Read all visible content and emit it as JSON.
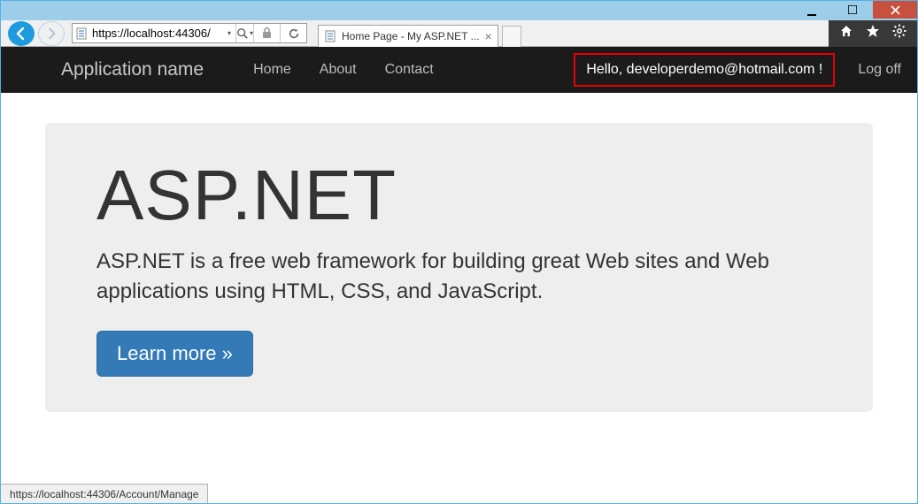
{
  "window": {
    "url": "https://localhost:44306/",
    "tab_title": "Home Page - My ASP.NET ...",
    "status_url": "https://localhost:44306/Account/Manage"
  },
  "navbar": {
    "brand": "Application name",
    "links": {
      "home": "Home",
      "about": "About",
      "contact": "Contact"
    },
    "greeting": "Hello, developerdemo@hotmail.com !",
    "logoff": "Log off"
  },
  "jumbo": {
    "heading": "ASP.NET",
    "lead": "ASP.NET is a free web framework for building great Web sites and Web applications using HTML, CSS, and JavaScript.",
    "button": "Learn more »"
  }
}
